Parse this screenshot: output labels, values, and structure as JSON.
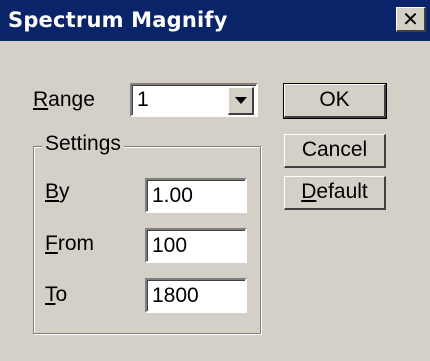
{
  "window": {
    "title": "Spectrum Magnify",
    "close_glyph": "✕"
  },
  "range": {
    "label_hotkey": "R",
    "label_rest": "ange",
    "value": "1"
  },
  "settings": {
    "group_label": "Settings",
    "by": {
      "label_hotkey": "B",
      "label_rest": "y",
      "value": "1.00"
    },
    "from": {
      "label_hotkey": "F",
      "label_rest": "rom",
      "value": "100"
    },
    "to": {
      "label_hotkey": "T",
      "label_rest": "o",
      "value": "1800"
    }
  },
  "buttons": {
    "ok": "OK",
    "cancel": "Cancel",
    "default_hotkey": "D",
    "default_rest": "efault"
  },
  "icons": {
    "dropdown": "chevron-down-icon",
    "close": "close-icon"
  },
  "colors": {
    "titlebar": "#0a246a",
    "face": "#d4d0c8"
  }
}
